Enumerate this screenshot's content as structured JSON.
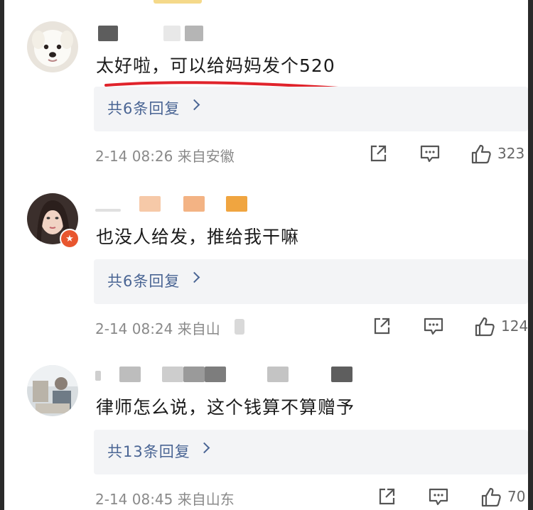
{
  "colors": {
    "link_blue": "#4a6594",
    "meta_gray": "#8a8a8a",
    "reply_box_bg": "#f3f4f6",
    "annotation_red": "#e0232b",
    "badge_orange": "#e8562f"
  },
  "comments": [
    {
      "avatar_icon": "white-dog-avatar",
      "text": "太好啦，可以给妈妈发个520",
      "replies_label": "共6条回复",
      "time_location": "2-14 08:26 来自安徽",
      "likes": "323"
    },
    {
      "avatar_icon": "woman-portrait-avatar",
      "text": "也没人给发，推给我干嘛",
      "replies_label": "共6条回复",
      "time_location": "2-14 08:24 来自山",
      "likes": "124"
    },
    {
      "avatar_icon": "photo-avatar",
      "text": "律师怎么说，这个钱算不算赠予",
      "replies_label": "共13条回复",
      "time_location": "2-14 08:45 来自山东",
      "likes": "70"
    }
  ],
  "icons": {
    "share": "share-icon",
    "comment": "comment-icon",
    "like": "thumbs-up-icon",
    "reply_arrow": "chevron-right-icon",
    "badge": "star-badge-icon"
  }
}
